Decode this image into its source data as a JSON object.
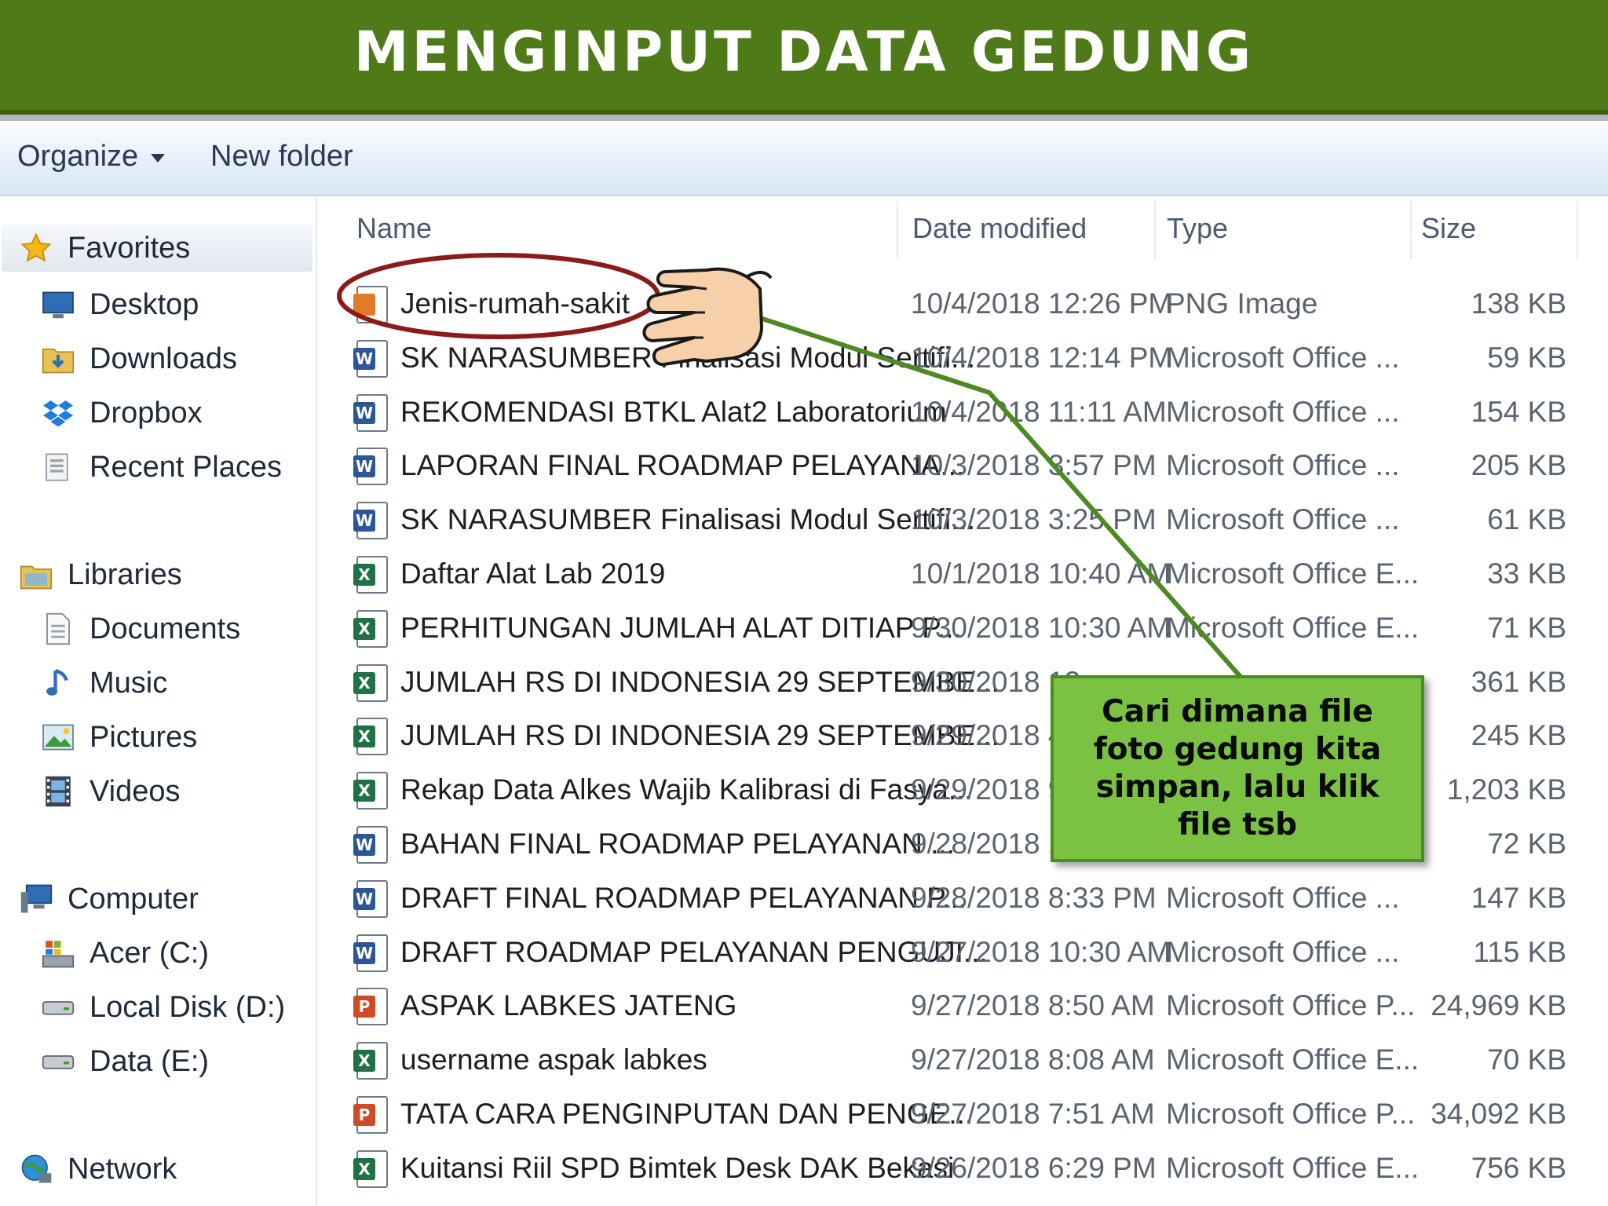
{
  "title": "MENGINPUT DATA GEDUNG",
  "toolbar": {
    "organize": "Organize",
    "new_folder": "New folder"
  },
  "nav": {
    "favorites": "Favorites",
    "desktop": "Desktop",
    "downloads": "Downloads",
    "dropbox": "Dropbox",
    "recent_places": "Recent Places",
    "libraries": "Libraries",
    "documents": "Documents",
    "music": "Music",
    "pictures": "Pictures",
    "videos": "Videos",
    "computer": "Computer",
    "acer_c": "Acer (C:)",
    "local_disk_d": "Local Disk (D:)",
    "data_e": "Data (E:)",
    "network": "Network"
  },
  "columns": {
    "name": "Name",
    "date": "Date modified",
    "type": "Type",
    "size": "Size"
  },
  "files": [
    {
      "name": "Jenis-rumah-sakit",
      "date": "10/4/2018 12:26 PM",
      "type": "PNG Image",
      "size": "138 KB",
      "icon": "png-image-icon"
    },
    {
      "name": "SK NARASUMBER Finalisasi Modul Sertifi...",
      "date": "10/4/2018 12:14 PM",
      "type": "Microsoft Office ...",
      "size": "59 KB",
      "icon": "word-doc-icon"
    },
    {
      "name": "REKOMENDASI BTKL Alat2 Laboratorium",
      "date": "10/4/2018 11:11 AM",
      "type": "Microsoft Office ...",
      "size": "154 KB",
      "icon": "word-doc-icon"
    },
    {
      "name": "LAPORAN FINAL ROADMAP PELAYANA...",
      "date": "10/3/2018 3:57 PM",
      "type": "Microsoft Office ...",
      "size": "205 KB",
      "icon": "word-doc-icon"
    },
    {
      "name": "SK NARASUMBER Finalisasi Modul Sertifi...",
      "date": "10/3/2018 3:25 PM",
      "type": "Microsoft Office ...",
      "size": "61 KB",
      "icon": "word-doc-icon"
    },
    {
      "name": "Daftar Alat Lab 2019",
      "date": "10/1/2018 10:40 AM",
      "type": "Microsoft Office E...",
      "size": "33 KB",
      "icon": "excel-sheet-icon"
    },
    {
      "name": "PERHITUNGAN JUMLAH ALAT DITIAP P...",
      "date": "9/30/2018 10:30 AM",
      "type": "Microsoft Office E...",
      "size": "71 KB",
      "icon": "excel-sheet-icon"
    },
    {
      "name": "JUMLAH RS DI INDONESIA 29 SEPTEMBE...",
      "date": "9/30/2018 12",
      "type": "",
      "size": "361 KB",
      "icon": "excel-sheet-icon"
    },
    {
      "name": "JUMLAH RS DI INDONESIA 29 SEPTEMBE...",
      "date": "9/29/2018 4:",
      "type": "",
      "size": "245 KB",
      "icon": "excel-sheet-icon"
    },
    {
      "name": "Rekap Data Alkes Wajib Kalibrasi di Fasya...",
      "date": "9/29/2018 9:",
      "type": "",
      "size": "1,203 KB",
      "icon": "excel-sheet-icon"
    },
    {
      "name": "BAHAN FINAL ROADMAP PELAYANAN ...",
      "date": "9/28/2018 11",
      "type": "",
      "size": "72 KB",
      "icon": "word-doc-icon"
    },
    {
      "name": "DRAFT FINAL ROADMAP PELAYANAN P...",
      "date": "9/28/2018 8:33 PM",
      "type": "Microsoft Office ...",
      "size": "147 KB",
      "icon": "word-doc-icon"
    },
    {
      "name": "DRAFT ROADMAP PELAYANAN PENGUJI...",
      "date": "9/27/2018 10:30 AM",
      "type": "Microsoft Office ...",
      "size": "115 KB",
      "icon": "word-doc-icon"
    },
    {
      "name": "ASPAK LABKES JATENG",
      "date": "9/27/2018 8:50 AM",
      "type": "Microsoft Office P...",
      "size": "24,969 KB",
      "icon": "powerpoint-icon"
    },
    {
      "name": "username aspak labkes",
      "date": "9/27/2018 8:08 AM",
      "type": "Microsoft Office E...",
      "size": "70 KB",
      "icon": "excel-sheet-icon"
    },
    {
      "name": "TATA CARA PENGINPUTAN DAN PENGE...",
      "date": "9/27/2018 7:51 AM",
      "type": "Microsoft Office P...",
      "size": "34,092 KB",
      "icon": "powerpoint-icon"
    },
    {
      "name": "Kuitansi Riil SPD Bimtek Desk DAK Bekasi",
      "date": "9/26/2018 6:29 PM",
      "type": "Microsoft Office E...",
      "size": "756 KB",
      "icon": "excel-sheet-icon"
    }
  ],
  "callout": {
    "text": "Cari dimana file foto gedung kita simpan, lalu klik file tsb"
  },
  "colors": {
    "banner": "#4e7b18",
    "callout_fill": "#7cc242",
    "highlight_ellipse": "#8b1a1a",
    "pointer_line": "#4c8a22",
    "hand_fill": "#f7cfa8",
    "word_icon": "#2b5797",
    "excel_icon": "#207245",
    "powerpoint_icon": "#d04a25",
    "png_icon": "#e07b2a"
  }
}
